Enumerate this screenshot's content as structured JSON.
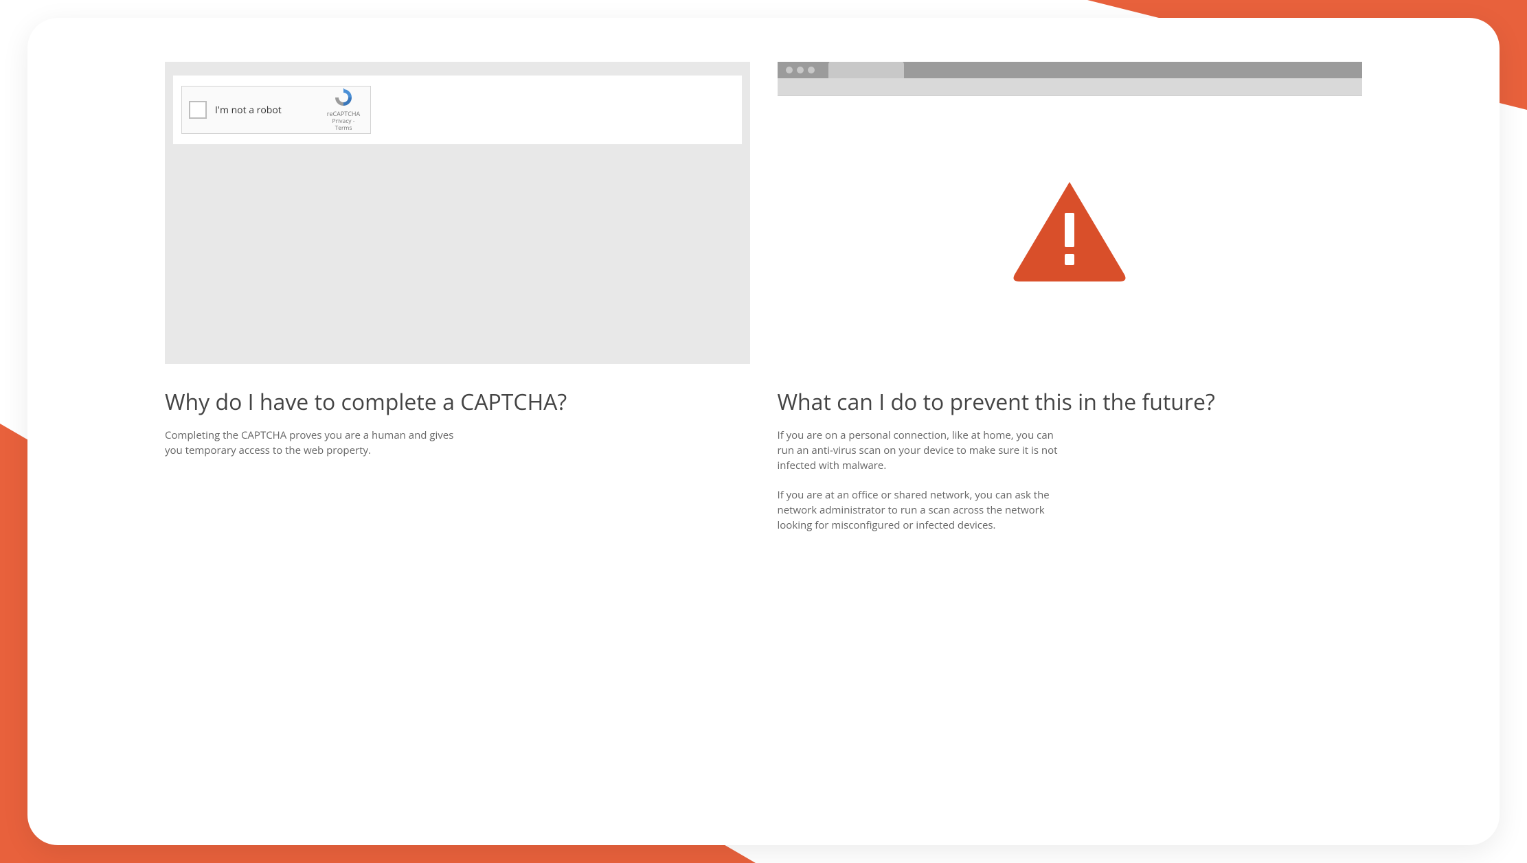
{
  "captcha": {
    "label": "I'm not a robot",
    "brand": "reCAPTCHA",
    "privacy": "Privacy",
    "sep": " - ",
    "terms": "Terms"
  },
  "left": {
    "heading": "Why do I have to complete a CAPTCHA?",
    "body": "Completing the CAPTCHA proves you are a human and gives you temporary access to the web property."
  },
  "right": {
    "heading": "What can I do to prevent this in the future?",
    "p1": "If you are on a personal connection, like at home, you can run an anti-virus scan on your device to make sure it is not infected with malware.",
    "p2": "If you are at an office or shared network, you can ask the network administrator to run a scan across the network looking for misconfigured or infected devices."
  },
  "colors": {
    "accent": "#d94f2a"
  }
}
